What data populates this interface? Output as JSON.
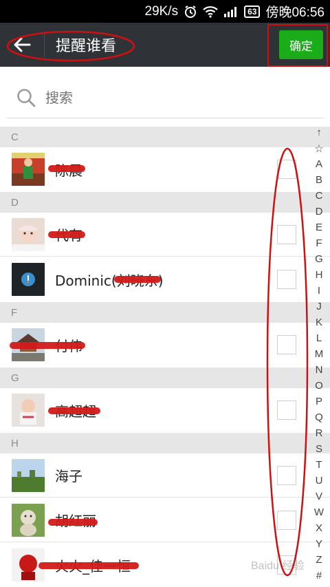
{
  "status_bar": {
    "speed": "29K/s",
    "battery": "63",
    "time": "傍晚06:56"
  },
  "header": {
    "title": "提醒谁看",
    "confirm_label": "确定"
  },
  "search": {
    "placeholder": "搜索"
  },
  "sections": [
    {
      "letter": "C",
      "contacts": [
        {
          "name": "陈晨"
        }
      ]
    },
    {
      "letter": "D",
      "contacts": [
        {
          "name": "代有"
        },
        {
          "name": "Dominic(刘晓东)"
        }
      ]
    },
    {
      "letter": "F",
      "contacts": [
        {
          "name": "付伟"
        }
      ]
    },
    {
      "letter": "G",
      "contacts": [
        {
          "name": "高超超"
        }
      ]
    },
    {
      "letter": "H",
      "contacts": [
        {
          "name": "海子"
        },
        {
          "name": "胡红丽"
        },
        {
          "name": "火火_佳一恒"
        }
      ]
    }
  ],
  "index_bar": {
    "letters": [
      "↑",
      "☆",
      "A",
      "B",
      "C",
      "D",
      "E",
      "F",
      "G",
      "H",
      "I",
      "J",
      "K",
      "L",
      "M",
      "N",
      "O",
      "P",
      "Q",
      "R",
      "S",
      "T",
      "U",
      "V",
      "W",
      "X",
      "Y",
      "Z",
      "#"
    ]
  },
  "watermark": "Baidu 经验",
  "colors": {
    "title_bar": "#2f3236",
    "confirm_button": "#1aad19",
    "annotation": "#d01010",
    "section_header": "#e6e6e6"
  }
}
